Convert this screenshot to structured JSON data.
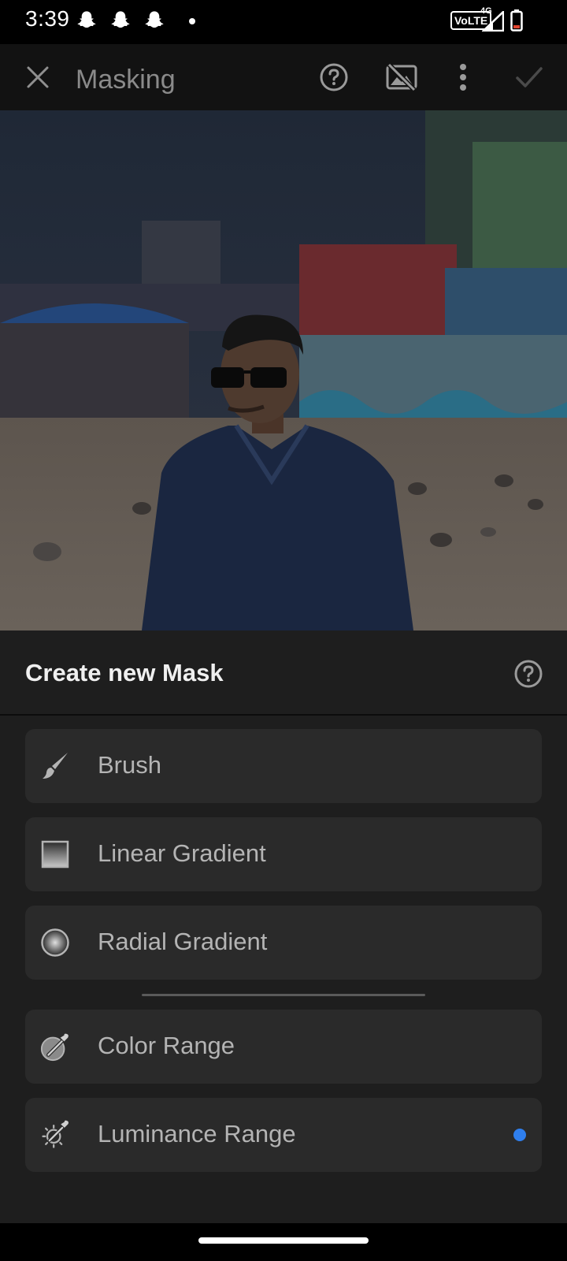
{
  "status_bar": {
    "time": "3:39",
    "notification_icons": [
      "snapchat-icon",
      "snapchat-icon",
      "snapchat-icon"
    ],
    "volte": "VoLTE",
    "network": "4G"
  },
  "toolbar": {
    "title": "Masking",
    "icons": [
      "close-icon",
      "help-icon",
      "mask-overlay-off-icon",
      "more-icon",
      "checkmark-icon"
    ]
  },
  "panel": {
    "title": "Create new Mask",
    "items": [
      {
        "label": "Brush",
        "icon": "brush-icon"
      },
      {
        "label": "Linear Gradient",
        "icon": "linear-gradient-icon"
      },
      {
        "label": "Radial Gradient",
        "icon": "radial-gradient-icon"
      },
      {
        "label": "Color Range",
        "icon": "color-range-icon"
      },
      {
        "label": "Luminance Range",
        "icon": "luminance-range-icon",
        "new_indicator": true
      }
    ]
  },
  "colors": {
    "accent": "#2f7fee",
    "panel_bg": "#1e1e1e",
    "item_bg": "#2a2a2a",
    "toolbar_bg": "#121212"
  }
}
